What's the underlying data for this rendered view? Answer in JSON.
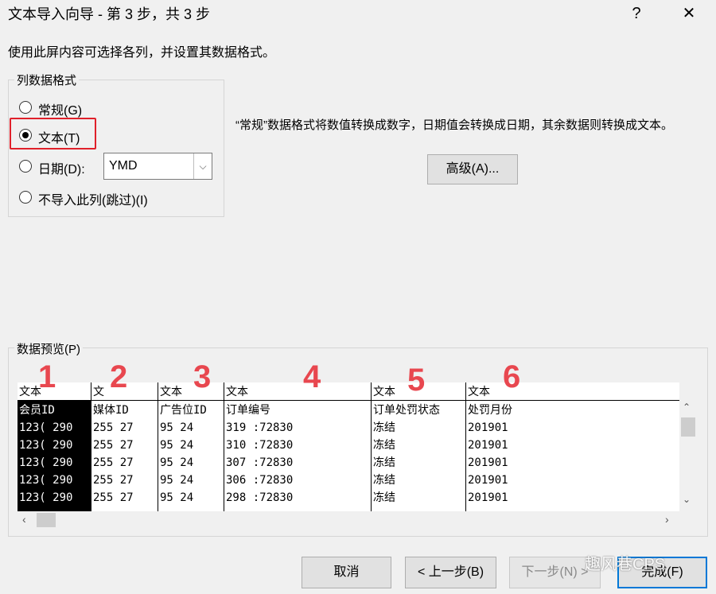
{
  "window": {
    "title": "文本导入向导 - 第 3 步，共 3 步",
    "help_label": "?",
    "close_label": "✕"
  },
  "instruction": "使用此屏内容可选择各列，并设置其数据格式。",
  "column_format": {
    "group_label": "列数据格式",
    "options": [
      {
        "label": "常规(G)",
        "selected": false
      },
      {
        "label": "文本(T)",
        "selected": true
      },
      {
        "label": "日期(D):",
        "selected": false
      },
      {
        "label": "不导入此列(跳过)(I)",
        "selected": false
      }
    ],
    "date_format_value": "YMD"
  },
  "description": "“常规”数据格式将数值转换成数字，日期值会转换成日期，其余数据则转换成文本。",
  "advanced_button": "高级(A)...",
  "preview": {
    "group_label": "数据预览(P)",
    "type_headers": [
      "文本",
      "文",
      "文本",
      "文本",
      "文本",
      "文本"
    ],
    "column_headers": [
      "会员ID",
      "媒体ID",
      "广告位ID",
      "订单编号",
      "订单处罚状态",
      "处罚月份"
    ],
    "rows": [
      [
        "123(     290",
        "255    27",
        "95      24",
        "319           :72830",
        "冻结",
        "201901"
      ],
      [
        "123(     290",
        "255     27",
        "95      24",
        "310           :72830",
        "冻结",
        "201901"
      ],
      [
        "123(     290",
        "255     27",
        "95      24",
        "307           :72830",
        "冻结",
        "201901"
      ],
      [
        "123(     290",
        "255     27",
        "95      24",
        "306           :72830",
        "冻结",
        "201901"
      ],
      [
        "123(     290",
        "255     27",
        "95      24",
        "298           :72830",
        "冻结",
        "201901"
      ]
    ],
    "annotations": [
      "1",
      "2",
      "3",
      "4",
      "5",
      "6"
    ]
  },
  "buttons": {
    "cancel": "取消",
    "back": "< 上一步(B)",
    "next": "下一步(N) >",
    "finish": "完成(F)"
  },
  "watermark": "趣风巷CPS"
}
